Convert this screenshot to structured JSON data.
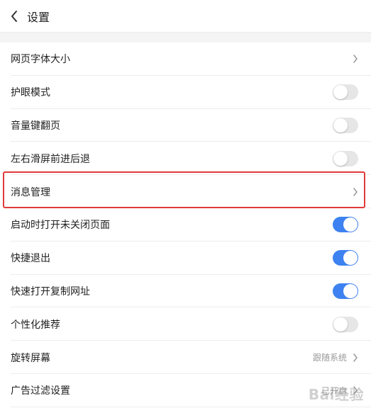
{
  "header": {
    "title": "设置"
  },
  "colors": {
    "accent": "#3d82f0",
    "highlight": "#e03a3a",
    "toggle_off": "#e6e6e6"
  },
  "settings": [
    {
      "label": "网页字体大小",
      "control": "chevron",
      "value": ""
    },
    {
      "label": "护眼模式",
      "control": "toggle",
      "on": false
    },
    {
      "label": "音量键翻页",
      "control": "toggle",
      "on": false
    },
    {
      "label": "左右滑屏前进后退",
      "control": "toggle",
      "on": false
    },
    {
      "label": "消息管理",
      "control": "chevron",
      "value": ""
    },
    {
      "label": "启动时打开未关闭页面",
      "control": "toggle",
      "on": true
    },
    {
      "label": "快捷退出",
      "control": "toggle",
      "on": true
    },
    {
      "label": "快速打开复制网址",
      "control": "toggle",
      "on": true
    },
    {
      "label": "个性化推荐",
      "control": "toggle",
      "on": false
    },
    {
      "label": "旋转屏幕",
      "control": "chevron",
      "value": "跟随系统"
    },
    {
      "label": "广告过滤设置",
      "control": "chevron",
      "value": "已开启"
    }
  ],
  "watermark": {
    "text": "Bai经验"
  }
}
